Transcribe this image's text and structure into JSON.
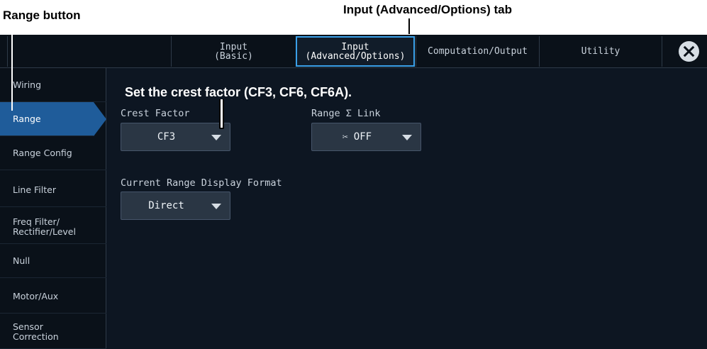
{
  "annotations": {
    "range_button": "Range button",
    "adv_tab": "Input (Advanced/Options) tab",
    "crest_instruction": "Set the crest factor (CF3, CF6, CF6A)."
  },
  "tabs": {
    "basic_line1": "Input",
    "basic_line2": "(Basic)",
    "adv_line1": "Input",
    "adv_line2": "(Advanced/Options)",
    "computation": "Computation/Output",
    "utility": "Utility",
    "active": "Input (Advanced/Options)"
  },
  "close_icon": "close-circle-icon",
  "sidebar": {
    "items": [
      {
        "label": "Wiring"
      },
      {
        "label": "Range",
        "active": true
      },
      {
        "label": "Range Config"
      },
      {
        "label": "Line Filter"
      },
      {
        "label_line1": "Freq Filter/",
        "label_line2": "Rectifier/Level"
      },
      {
        "label": "Null"
      },
      {
        "label": "Motor/Aux"
      },
      {
        "label_line1": "Sensor",
        "label_line2": "Correction"
      }
    ]
  },
  "settings": {
    "crest_factor": {
      "label": "Crest Factor",
      "value": "CF3"
    },
    "range_link": {
      "label": "Range Σ Link",
      "value": "OFF",
      "icon": "link-off-icon"
    },
    "current_range_format": {
      "label": "Current Range Display Format",
      "value": "Direct"
    }
  },
  "colors": {
    "background": "#0d1622",
    "active_item": "#1f5c9a",
    "active_tab_border": "#3aa0e8",
    "dropdown": "#2a3644"
  }
}
